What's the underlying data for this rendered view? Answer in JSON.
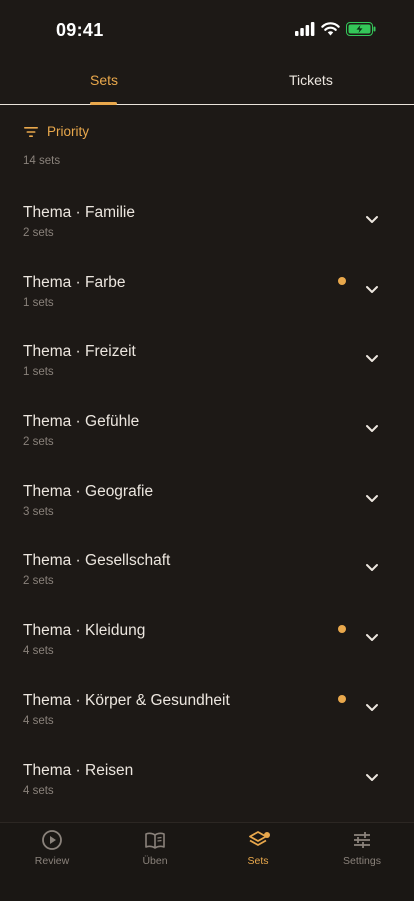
{
  "status": {
    "time": "09:41"
  },
  "tabs": [
    {
      "label": "Sets",
      "active": true
    },
    {
      "label": "Tickets",
      "active": false
    }
  ],
  "filter": {
    "label": "Priority",
    "icon": "filter-icon"
  },
  "list_count": "14 sets",
  "items": [
    {
      "title": "Thema · Familie",
      "subtitle": "2 sets",
      "dot": false
    },
    {
      "title": "Thema · Farbe",
      "subtitle": "1 sets",
      "dot": true
    },
    {
      "title": "Thema · Freizeit",
      "subtitle": "1 sets",
      "dot": false
    },
    {
      "title": "Thema · Gefühle",
      "subtitle": "2 sets",
      "dot": false
    },
    {
      "title": "Thema · Geografie",
      "subtitle": "3 sets",
      "dot": false
    },
    {
      "title": "Thema · Gesellschaft",
      "subtitle": "2 sets",
      "dot": false
    },
    {
      "title": "Thema · Kleidung",
      "subtitle": "4 sets",
      "dot": true
    },
    {
      "title": "Thema · Körper & Gesundheit",
      "subtitle": "4 sets",
      "dot": true
    },
    {
      "title": "Thema · Reisen",
      "subtitle": "4 sets",
      "dot": false
    }
  ],
  "nav": [
    {
      "label": "Review",
      "icon": "play-circle-icon",
      "active": false
    },
    {
      "label": "Üben",
      "icon": "book-icon",
      "active": false
    },
    {
      "label": "Sets",
      "icon": "layers-icon",
      "active": true,
      "badge": true
    },
    {
      "label": "Settings",
      "icon": "sliders-icon",
      "active": false
    }
  ],
  "colors": {
    "accent": "#e9a84c",
    "background": "#1d1916",
    "battery": "#34c759"
  }
}
